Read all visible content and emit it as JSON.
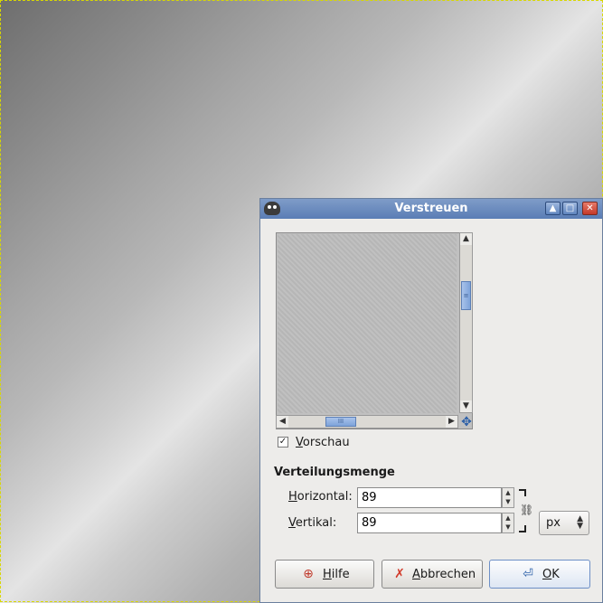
{
  "dialog": {
    "title": "Verstreuen",
    "titlebar_buttons": {
      "up_icon": "arrow-up-icon",
      "maximize_icon": "maximize-icon",
      "close_icon": "close-icon"
    }
  },
  "preview": {
    "checkbox_checked": true,
    "label_mnemonic": "V",
    "label_rest": "orschau"
  },
  "section": {
    "title": "Verteilungsmenge",
    "horizontal": {
      "label_mnemonic": "H",
      "label_rest": "orizontal:",
      "value": "89"
    },
    "vertical": {
      "label_mnemonic": "V",
      "label_rest": "ertikal:",
      "value": "89"
    },
    "unit": "px"
  },
  "buttons": {
    "help": {
      "mnemonic": "H",
      "rest": "ilfe"
    },
    "cancel": {
      "mnemonic": "A",
      "rest": "bbrechen"
    },
    "ok": {
      "mnemonic": "O",
      "rest": "K"
    }
  },
  "colors": {
    "titlebar": "#5a7db5",
    "dialog_bg": "#edecea",
    "accent": "#2b5fa8"
  }
}
